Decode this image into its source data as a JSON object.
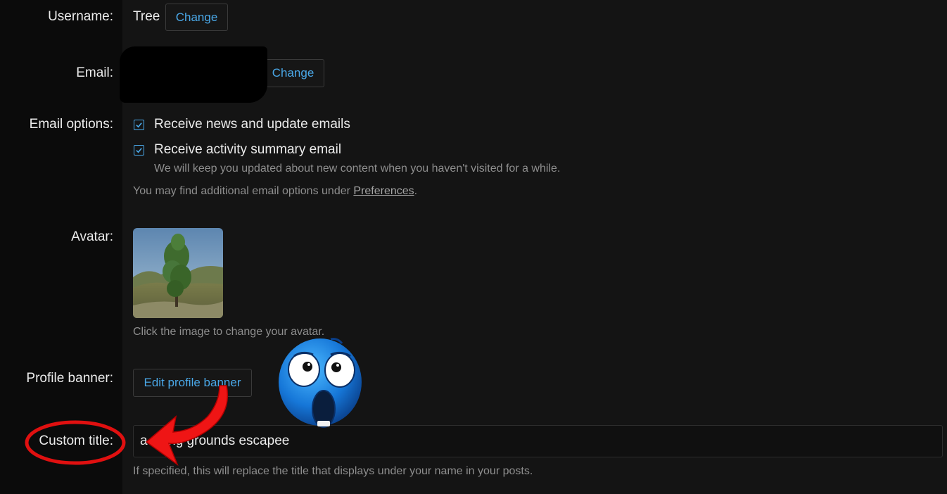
{
  "username": {
    "label": "Username:",
    "value": "Tree",
    "button": "Change"
  },
  "email": {
    "label": "Email:",
    "button": "Change"
  },
  "email_options": {
    "label": "Email options:",
    "options": [
      {
        "label": "Receive news and update emails",
        "checked": true
      },
      {
        "label": "Receive activity summary email",
        "checked": true
      }
    ],
    "activity_hint": "We will keep you updated about new content when you haven't visited for a while.",
    "prefs_hint_before": "You may find additional email options under ",
    "prefs_link": "Preferences",
    "prefs_hint_after": "."
  },
  "avatar": {
    "label": "Avatar:",
    "hint": "Click the image to change your avatar."
  },
  "profile_banner": {
    "label": "Profile banner:",
    "button": "Edit profile banner"
  },
  "custom_title": {
    "label": "Custom title:",
    "value": "a         oving grounds escapee",
    "hint": "If specified, this will replace the title that displays under your name in your posts."
  },
  "colors": {
    "accent": "#4aa8e8",
    "annotation_red": "#e01010"
  },
  "icons": [
    "checkbox-icon",
    "red-arrow",
    "red-circle",
    "shocked-emoji"
  ]
}
